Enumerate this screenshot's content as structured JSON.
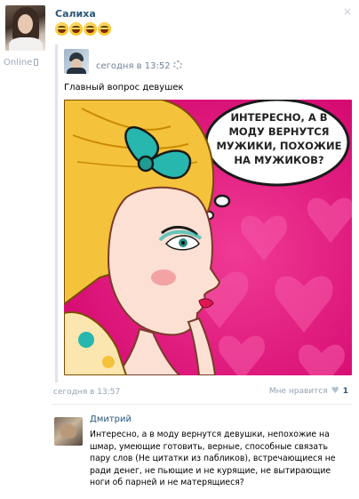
{
  "post": {
    "author": "Салиха",
    "status": "Online",
    "close_glyph": "×",
    "emojis": [
      "😂",
      "😂",
      "😂",
      "😂"
    ]
  },
  "repost": {
    "time": "сегодня в 13:52",
    "text": "Главный вопрос девушек",
    "image": {
      "speech_bubble_lines": [
        "ИНТЕРЕСНО, А В",
        "МОДУ ВЕРНУТСЯ",
        "МУЖИКИ, ПОХОЖИЕ",
        "НА МУЖИКОВ?"
      ],
      "colors": {
        "background": "#e5157e",
        "hearts": "#f34fa0",
        "hair": "#f4c33b",
        "bow": "#27b7ae",
        "skin": "#fbe0d3",
        "lips": "#e11552"
      }
    }
  },
  "footer": {
    "time": "сегодня в 13:57",
    "like_label": "Мне нравится",
    "like_count": "1"
  },
  "comment": {
    "author": "Дмитрий",
    "text": "Интересно, а в моду вернутся девушки, непохожие на шмар, умеющие готовить, верные, способные связать пару слов (Не цитатки из пабликов), встречающиеся не ради денег, не пьющие и не курящие, не вытирающие ноги об парней и не матерящиеся?"
  },
  "colors": {
    "link": "#2b587a",
    "muted": "#93a3b5"
  }
}
